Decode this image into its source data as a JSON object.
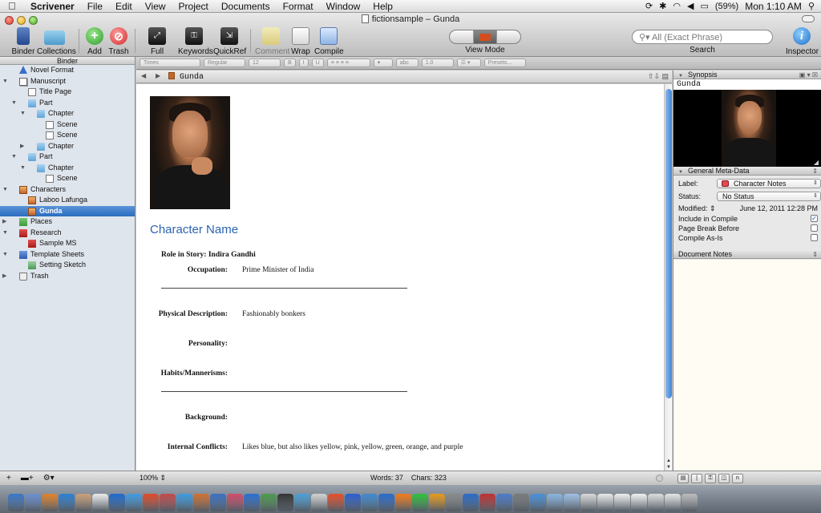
{
  "menubar": {
    "app_name": "Scrivener",
    "menus": [
      "File",
      "Edit",
      "View",
      "Project",
      "Documents",
      "Format",
      "Window",
      "Help"
    ],
    "battery": "(59%)",
    "clock": "Mon 1:10 AM"
  },
  "window": {
    "title": "fictionsample – Gunda"
  },
  "toolbar": {
    "binder": "Binder",
    "collections": "Collections",
    "add": "Add",
    "trash": "Trash",
    "full_screen": "Full Screen",
    "keywords": "Keywords",
    "quickref": "QuickRef",
    "comment": "Comment",
    "wrap": "Wrap",
    "compile": "Compile",
    "view_mode": "View Mode",
    "search_placeholder": "All (Exact Phrase)",
    "search": "Search",
    "inspector": "Inspector"
  },
  "formatbar": {
    "font": "Times",
    "style": "Regular",
    "size": "12",
    "bold": "B",
    "italic": "I",
    "underline": "U",
    "highlight": "abc",
    "spacing": "1.0",
    "presets": "Presets..."
  },
  "binder": {
    "header": "Binder",
    "items": [
      {
        "label": "Novel Format",
        "level": 0,
        "icon": "warning-icon",
        "tri": ""
      },
      {
        "label": "Manuscript",
        "level": 0,
        "icon": "manuscript-icon",
        "tri": "▼"
      },
      {
        "label": "Title Page",
        "level": 1,
        "icon": "document-icon",
        "tri": ""
      },
      {
        "label": "Part",
        "level": 1,
        "icon": "folder-icon",
        "tri": "▼"
      },
      {
        "label": "Chapter",
        "level": 2,
        "icon": "folder-icon",
        "tri": "▼"
      },
      {
        "label": "Scene",
        "level": 3,
        "icon": "document-icon",
        "tri": ""
      },
      {
        "label": "Scene",
        "level": 3,
        "icon": "document-icon",
        "tri": ""
      },
      {
        "label": "Chapter",
        "level": 2,
        "icon": "folder-icon",
        "tri": "▶"
      },
      {
        "label": "Part",
        "level": 1,
        "icon": "folder-icon",
        "tri": "▼"
      },
      {
        "label": "Chapter",
        "level": 2,
        "icon": "folder-icon",
        "tri": "▼"
      },
      {
        "label": "Scene",
        "level": 3,
        "icon": "document-icon",
        "tri": ""
      },
      {
        "label": "Characters",
        "level": 0,
        "icon": "characters-icon",
        "tri": "▼"
      },
      {
        "label": "Laboo Lafunga",
        "level": 1,
        "icon": "character-sheet-icon",
        "tri": ""
      },
      {
        "label": "Gunda",
        "level": 1,
        "icon": "character-sheet-icon",
        "tri": "",
        "selected": true
      },
      {
        "label": "Places",
        "level": 0,
        "icon": "places-icon",
        "tri": "▶"
      },
      {
        "label": "Research",
        "level": 0,
        "icon": "research-icon",
        "tri": "▼"
      },
      {
        "label": "Sample MS",
        "level": 1,
        "icon": "pdf-icon",
        "tri": ""
      },
      {
        "label": "Template Sheets",
        "level": 0,
        "icon": "template-icon",
        "tri": "▼"
      },
      {
        "label": "Setting Sketch",
        "level": 1,
        "icon": "sketch-icon",
        "tri": ""
      },
      {
        "label": "Trash",
        "level": 0,
        "icon": "trash-icon",
        "tri": "▶"
      }
    ]
  },
  "editor": {
    "header_title": "Gunda",
    "heading": "Character Name",
    "role_line": "Role in Story: Indira Gandhi",
    "fields": [
      {
        "label": "Occupation:",
        "value": "Prime Minister of India"
      },
      {
        "label": "Physical Description:",
        "value": "Fashionably bonkers"
      },
      {
        "label": "Personality:",
        "value": ""
      },
      {
        "label": "Habits/Mannerisms:",
        "value": ""
      },
      {
        "label": "Background:",
        "value": ""
      },
      {
        "label": "Internal Conflicts:",
        "value": "Likes blue, but also likes yellow, pink, yellow, green, orange, and purple"
      }
    ],
    "zoom": "100%",
    "word_count": "Words: 37",
    "char_count": "Chars: 323"
  },
  "inspector": {
    "synopsis_label": "Synopsis",
    "synopsis_title": "Gunda",
    "metadata_label": "General Meta-Data",
    "label_field": "Label:",
    "label_value": "Character Notes",
    "label_color": "#e14b55",
    "status_field": "Status:",
    "status_value": "No Status",
    "modified_field": "Modified:",
    "modified_value": "June 12, 2011 12:28 PM",
    "include_compile": "Include in Compile",
    "page_break": "Page Break Before",
    "compile_as_is": "Compile As-Is",
    "include_checked": true,
    "page_break_checked": false,
    "compile_as_is_checked": false,
    "notes_label": "Document Notes"
  }
}
